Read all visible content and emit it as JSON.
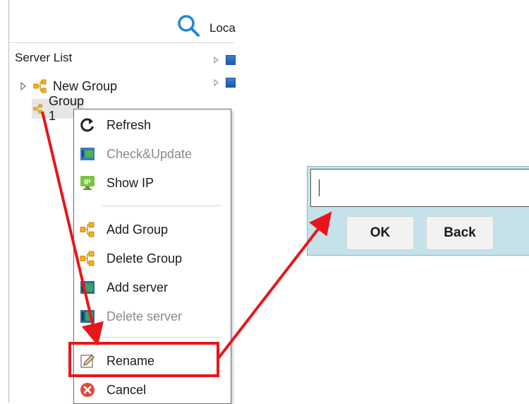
{
  "server_panel": {
    "title": "Server List",
    "search_icon": "search-icon",
    "tree": [
      {
        "label": "New Group",
        "icon": "group-icon"
      },
      {
        "label": "Group 1",
        "icon": "group-icon"
      }
    ]
  },
  "right_panel": {
    "header": "Loca"
  },
  "context_menu": {
    "items": [
      {
        "label": "Refresh",
        "icon": "refresh-icon",
        "disabled": false
      },
      {
        "label": "Check&Update",
        "icon": "check-update-icon",
        "disabled": true
      },
      {
        "label": "Show IP",
        "icon": "ip-icon",
        "disabled": false
      },
      {
        "label": "Add Group",
        "icon": "group-icon",
        "disabled": false
      },
      {
        "label": "Delete Group",
        "icon": "group-icon",
        "disabled": false
      },
      {
        "label": "Add server",
        "icon": "server-icon",
        "disabled": false
      },
      {
        "label": "Delete server",
        "icon": "server-icon",
        "disabled": true
      },
      {
        "label": "Rename",
        "icon": "pencil-icon",
        "disabled": false
      },
      {
        "label": "Cancel",
        "icon": "cancel-icon",
        "disabled": false
      }
    ]
  },
  "rename_dialog": {
    "input_value": "",
    "ok_label": "OK",
    "back_label": "Back"
  },
  "colors": {
    "annotation_red": "#e8161b",
    "search_blue": "#1f87d6",
    "dialog_bg": "#c5e2ea"
  }
}
